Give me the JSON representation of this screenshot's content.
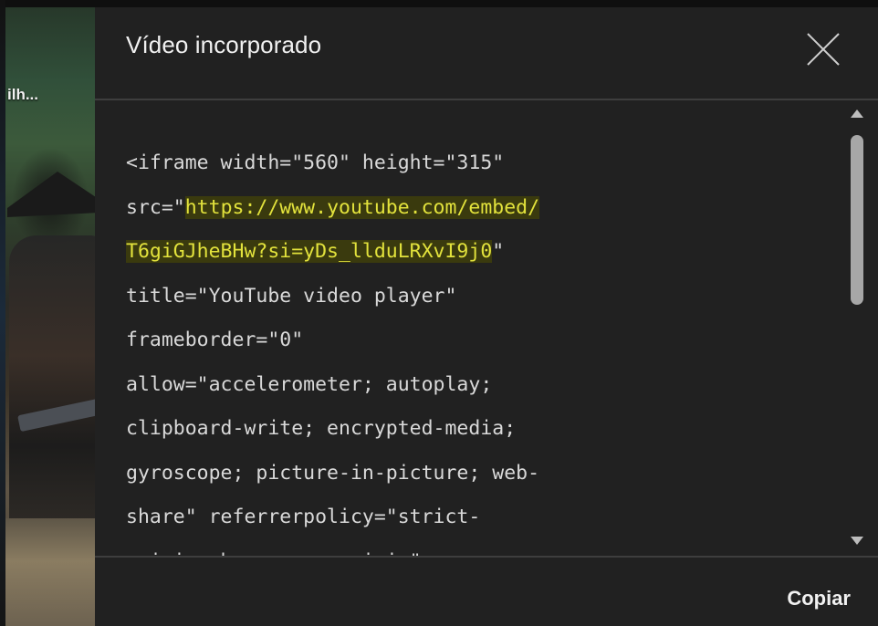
{
  "background": {
    "video_title_fragment": "ilh..."
  },
  "dialog": {
    "title": "Vídeo incorporado",
    "close_icon": "close-icon",
    "code": {
      "lines": [
        {
          "segments": [
            {
              "text": "<iframe width=\"560\" height=\"315\"",
              "highlight": false
            }
          ]
        },
        {
          "segments": [
            {
              "text": "src=\"",
              "highlight": false
            },
            {
              "text": "https://www.youtube.com/embed/",
              "highlight": true
            }
          ]
        },
        {
          "segments": [
            {
              "text": "T6giGJheBHw?si=yDs_llduLRXvI9j0",
              "highlight": true
            },
            {
              "text": "\"",
              "highlight": false
            }
          ]
        },
        {
          "segments": [
            {
              "text": "title=\"YouTube video player\"",
              "highlight": false
            }
          ]
        },
        {
          "segments": [
            {
              "text": "frameborder=\"0\"",
              "highlight": false
            }
          ]
        },
        {
          "segments": [
            {
              "text": "allow=\"accelerometer; autoplay;",
              "highlight": false
            }
          ]
        },
        {
          "segments": [
            {
              "text": "clipboard-write; encrypted-media;",
              "highlight": false
            }
          ]
        },
        {
          "segments": [
            {
              "text": "gyroscope; picture-in-picture; web-",
              "highlight": false
            }
          ]
        },
        {
          "segments": [
            {
              "text": "share\" referrerpolicy=\"strict-",
              "highlight": false
            }
          ]
        },
        {
          "segments": [
            {
              "text": "origin-when-cross-origin\"",
              "highlight": false
            }
          ]
        }
      ]
    },
    "copy_label": "Copiar"
  },
  "colors": {
    "dialog_bg": "#212121",
    "highlight_bg": "#3a3a0e",
    "highlight_text": "#e2e23c",
    "divider": "#3e3e3e"
  }
}
